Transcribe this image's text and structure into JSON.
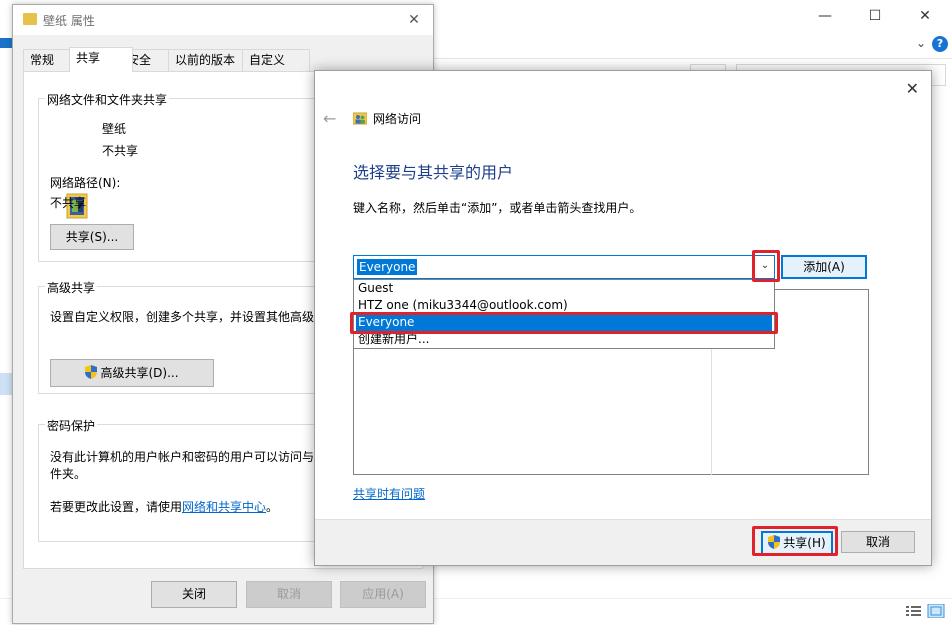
{
  "background_window": {
    "minimize_glyph": "—",
    "maximize_glyph": "☐",
    "close_glyph": "✕",
    "help_glyph": "?",
    "expand_ribbon_glyph": "⌄"
  },
  "properties_dialog": {
    "title": "壁纸 属性",
    "close_glyph": "✕",
    "tabs": [
      {
        "label": "常规",
        "active": false
      },
      {
        "label": "共享",
        "active": true
      },
      {
        "label": "安全",
        "active": false
      },
      {
        "label": "以前的版本",
        "active": false
      },
      {
        "label": "自定义",
        "active": false
      }
    ],
    "network_sharing": {
      "group_label": "网络文件和文件夹共享",
      "folder_name": "壁纸",
      "share_state": "不共享",
      "path_label": "网络路径(N):",
      "path_value": "不共享",
      "share_button": "共享(S)..."
    },
    "advanced_sharing": {
      "group_label": "高级共享",
      "description": "设置自定义权限，创建多个共享，并设置其他高级共",
      "button": "高级共享(D)..."
    },
    "password_protection": {
      "group_label": "密码保护",
      "description_line1": "没有此计算机的用户帐户和密码的用户可以访问与此",
      "description_line2": "件夹。",
      "change_prefix": "若要更改此设置，请使用",
      "change_link": "网络和共享中心",
      "change_suffix": "。"
    },
    "footer": {
      "close": "关闭",
      "cancel": "取消",
      "apply": "应用(A)"
    }
  },
  "wizard": {
    "close_glyph": "✕",
    "back_glyph": "←",
    "title": "网络访问",
    "heading": "选择要与其共享的用户",
    "instruction": "键入名称，然后单击“添加”，或者单击箭头查找用户。",
    "combo_value": "Everyone",
    "combo_arrow_glyph": "⌄",
    "add_button": "添加(A)",
    "dropdown_options": [
      {
        "label": "Guest",
        "selected": false
      },
      {
        "label": "HTZ one (miku3344@outlook.com)",
        "selected": false
      },
      {
        "label": "Everyone",
        "selected": true
      },
      {
        "label": "创建新用户...",
        "selected": false
      }
    ],
    "help_link": "共享时有问题",
    "share_button": "共享(H)",
    "cancel_button": "取消"
  },
  "colors": {
    "accent": "#0078d7",
    "highlight_red": "#e0222a",
    "heading_blue": "#1e3f8a",
    "link_blue": "#0066cc",
    "dialog_bg": "#f0f0f0"
  },
  "icons": [
    "folder-icon",
    "shield-icon",
    "network-users-icon",
    "back-arrow-icon",
    "close-icon",
    "chevron-down-icon",
    "help-icon"
  ]
}
